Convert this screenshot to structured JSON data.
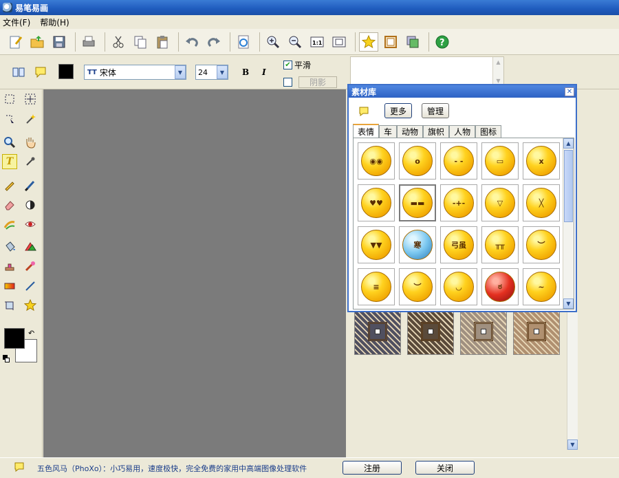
{
  "app": {
    "title": "易笔易画"
  },
  "menu": {
    "file": "文件(F)",
    "help": "帮助(H)"
  },
  "toolbar": {
    "items": [
      "new-file-icon",
      "open-folder-icon",
      "save-icon",
      "print-icon",
      "cut-icon",
      "copy-icon",
      "paste-icon",
      "undo-icon",
      "redo-icon",
      "refresh-icon",
      "zoom-in-icon",
      "zoom-out-icon",
      "actual-size-icon",
      "fit-window-icon",
      "star-icon",
      "frame-icon",
      "layers-icon",
      "help-icon"
    ]
  },
  "options": {
    "font": "宋体",
    "font_size": "24",
    "bold": "B",
    "italic": "I",
    "smooth_label": "平滑",
    "shadow_label": "阴影",
    "text_color": "#000000"
  },
  "panel": {
    "title": "素材库",
    "more_button": "更多",
    "manage_button": "管理",
    "tabs": [
      "表情",
      "车",
      "动物",
      "旗帜",
      "人物",
      "图标"
    ],
    "active_tab": "表情",
    "faces": [
      {
        "glyph": "◉◉",
        "variant": ""
      },
      {
        "glyph": "o",
        "variant": ""
      },
      {
        "glyph": "- -",
        "variant": ""
      },
      {
        "glyph": "▭",
        "variant": ""
      },
      {
        "glyph": "x",
        "variant": ""
      },
      {
        "glyph": "♥♥",
        "variant": ""
      },
      {
        "glyph": "▬▬",
        "variant": ""
      },
      {
        "glyph": "-+-",
        "variant": ""
      },
      {
        "glyph": "▽",
        "variant": ""
      },
      {
        "glyph": "╳",
        "variant": ""
      },
      {
        "glyph": "▼▼",
        "variant": ""
      },
      {
        "glyph": "寒",
        "variant": "blue"
      },
      {
        "glyph": "弓虽",
        "variant": ""
      },
      {
        "glyph": "╥╥",
        "variant": ""
      },
      {
        "glyph": "︶",
        "variant": ""
      },
      {
        "glyph": "≡",
        "variant": ""
      },
      {
        "glyph": "︶",
        "variant": ""
      },
      {
        "glyph": "◡",
        "variant": ""
      },
      {
        "glyph": "ಠ",
        "variant": "red"
      },
      {
        "glyph": "~",
        "variant": ""
      }
    ]
  },
  "frames": {
    "colors": [
      "#b08860",
      "#7a5a40",
      "#c8a070",
      "#3aa8b0",
      "#9a7020",
      "#6a6a30",
      "#c0a080",
      "#8a5a30",
      "#505060",
      "#5a4a3a",
      "#a09080",
      "#b09070"
    ]
  },
  "status": {
    "text": "五色风马（PhoXo）：小巧易用，速度极快，完全免费的家用中高端图像处理软件",
    "register_button": "注册",
    "close_button": "关闭"
  }
}
